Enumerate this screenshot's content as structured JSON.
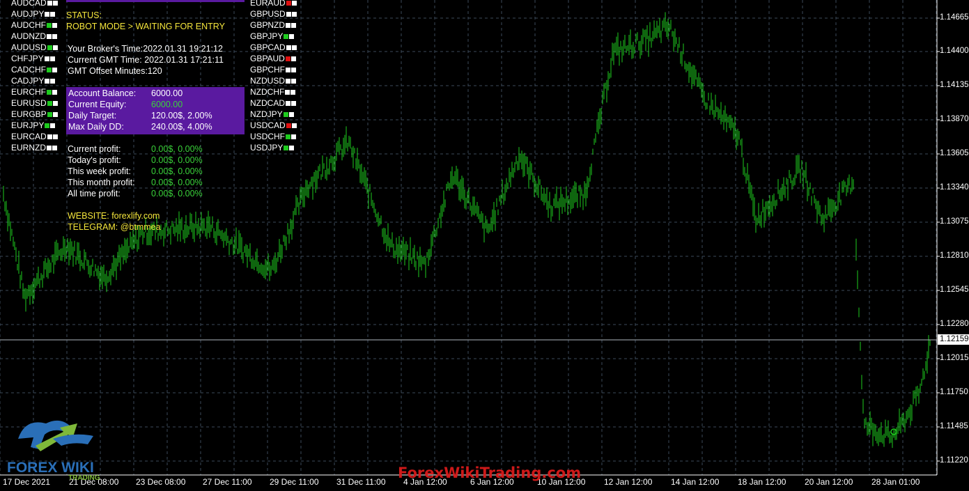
{
  "pairs_left": [
    {
      "name": "AUDCAD",
      "status": "white"
    },
    {
      "name": "AUDJPY",
      "status": "white"
    },
    {
      "name": "AUDCHF",
      "status": "green"
    },
    {
      "name": "AUDNZD",
      "status": "white"
    },
    {
      "name": "AUDUSD",
      "status": "green"
    },
    {
      "name": "CHFJPY",
      "status": "white"
    },
    {
      "name": "CADCHF",
      "status": "green"
    },
    {
      "name": "CADJPY",
      "status": "white"
    },
    {
      "name": "EURCHF",
      "status": "green"
    },
    {
      "name": "EURUSD",
      "status": "green"
    },
    {
      "name": "EURGBP",
      "status": "green"
    },
    {
      "name": "EURJPY",
      "status": "green"
    },
    {
      "name": "EURCAD",
      "status": "white"
    },
    {
      "name": "EURNZD",
      "status": "white"
    }
  ],
  "pairs_right": [
    {
      "name": "EURAUD",
      "status": "red"
    },
    {
      "name": "GBPUSD",
      "status": "white"
    },
    {
      "name": "GBPNZD",
      "status": "white"
    },
    {
      "name": "GBPJPY",
      "status": "green"
    },
    {
      "name": "GBPCAD",
      "status": "white"
    },
    {
      "name": "GBPAUD",
      "status": "red"
    },
    {
      "name": "GBPCHF",
      "status": "white"
    },
    {
      "name": "NZDUSD",
      "status": "white"
    },
    {
      "name": "NZDCHF",
      "status": "white"
    },
    {
      "name": "NZDCAD",
      "status": "white"
    },
    {
      "name": "NZDJPY",
      "status": "green"
    },
    {
      "name": "USDCAD",
      "status": "red"
    },
    {
      "name": "USDCHF",
      "status": "green"
    },
    {
      "name": "USDJPY",
      "status": "green"
    }
  ],
  "status_colors": {
    "white": "#ffffff",
    "green": "#1ecb1e",
    "red": "#e01010"
  },
  "panel": {
    "status_label": "STATUS:",
    "status_value": "ROBOT MODE > WAITING FOR ENTRY",
    "broker_time": "Your Broker's Time:2022.01.31 19:21:12",
    "gmt_time": "Current GMT Time: 2022.01.31 17:21:11",
    "gmt_offset": "GMT Offset Minutes:120",
    "account": [
      {
        "label": "Account Balance:",
        "value": "6000.00",
        "value_color": "white"
      },
      {
        "label": "Current Equity:",
        "value": "6000.00",
        "value_color": "green"
      },
      {
        "label": "Daily Target:",
        "value": "120.00$, 2.00%",
        "value_color": "white"
      },
      {
        "label": "Max Daily DD:",
        "value": "240.00$, 4.00%",
        "value_color": "white"
      }
    ],
    "profits": [
      {
        "label": "Current profit:",
        "value": "0.00$, 0.00%"
      },
      {
        "label": "Today's profit:",
        "value": "0.00$, 0.00%"
      },
      {
        "label": "This week profit:",
        "value": "0.00$, 0.00%"
      },
      {
        "label": "This month profit:",
        "value": "0.00$, 0.00%"
      },
      {
        "label": "All time profit:",
        "value": "0.00$, 0.00%"
      }
    ],
    "website": "WEBSITE: forexlify.com",
    "telegram": "TELEGRAM: @btmmea"
  },
  "price_axis": [
    "1.14665",
    "1.14400",
    "1.14135",
    "1.13870",
    "1.13605",
    "1.13340",
    "1.13075",
    "1.12810",
    "1.12545",
    "1.12280",
    "1.12015",
    "1.11750",
    "1.11485",
    "1.11220"
  ],
  "current_price": "1.12159",
  "date_axis": [
    "17 Dec 2021",
    "21 Dec 08:00",
    "23 Dec 08:00",
    "27 Dec 11:00",
    "29 Dec 11:00",
    "31 Dec 11:00",
    "4 Jan 12:00",
    "6 Jan 12:00",
    "10 Jan 12:00",
    "12 Jan 12:00",
    "14 Jan 12:00",
    "18 Jan 12:00",
    "20 Jan 12:00",
    "28 Jan 01:00"
  ],
  "watermark": "ForexWikiTrading.com",
  "logo_text_top": "FOREX WIKI",
  "logo_text_bottom": "TRADING",
  "colors": {
    "candle": "#1ecb1e",
    "grid": "#3c4a5a",
    "background": "#000000",
    "panel_purple": "#5a1aa0",
    "text_yellow": "#f5e63c",
    "watermark": "#d81b1b"
  },
  "chart_data": {
    "type": "line",
    "symbol": "EURUSD",
    "grid": true,
    "ylim": [
      1.1122,
      1.14665
    ],
    "x": [
      "17 Dec 2021",
      "21 Dec 08:00",
      "23 Dec 08:00",
      "27 Dec 11:00",
      "29 Dec 11:00",
      "31 Dec 11:00",
      "4 Jan 12:00",
      "6 Jan 12:00",
      "10 Jan 12:00",
      "12 Jan 12:00",
      "14 Jan 12:00",
      "18 Jan 12:00",
      "20 Jan 12:00",
      "28 Jan 01:00"
    ],
    "values": [
      1.133,
      1.1255,
      1.1285,
      1.13,
      1.131,
      1.1345,
      1.128,
      1.13,
      1.1345,
      1.137,
      1.144,
      1.145,
      1.142,
      1.139,
      1.133,
      1.134,
      1.131,
      1.134,
      1.135,
      1.115,
      1.1145,
      1.1175,
      1.1216
    ]
  }
}
